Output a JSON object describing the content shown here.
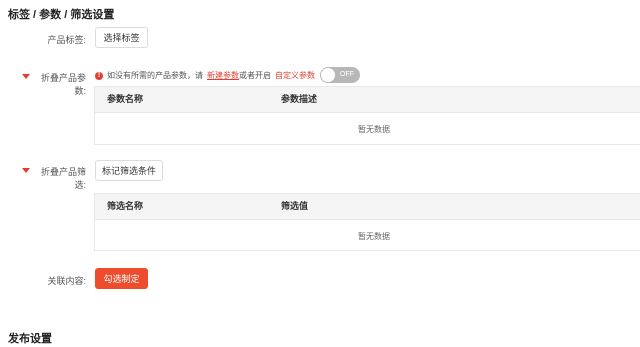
{
  "sections": {
    "tags_params_filters": "标签 / 参数 / 筛选设置",
    "publish": "发布设置"
  },
  "product_tags": {
    "label": "产品标签:",
    "button": "选择标签"
  },
  "params": {
    "label": "折叠产品参数:",
    "hint_prefix": "如没有所需的产品参数，请",
    "hint_link": "新建参数",
    "hint_mid": "或者开启",
    "hint_custom": "自定义参数",
    "toggle_text": "OFF",
    "table": {
      "columns": [
        "参数名称",
        "参数描述"
      ],
      "empty": "暂无数据"
    }
  },
  "filters": {
    "label": "折叠产品筛选:",
    "button": "标记筛选条件",
    "table": {
      "columns": [
        "筛选名称",
        "筛选值"
      ],
      "empty": "暂无数据"
    }
  },
  "related": {
    "label": "关联内容:",
    "button": "勾选制定"
  },
  "colors": {
    "accent_red": "#ee4d2d",
    "toggle_off": "#b8b8b8"
  }
}
